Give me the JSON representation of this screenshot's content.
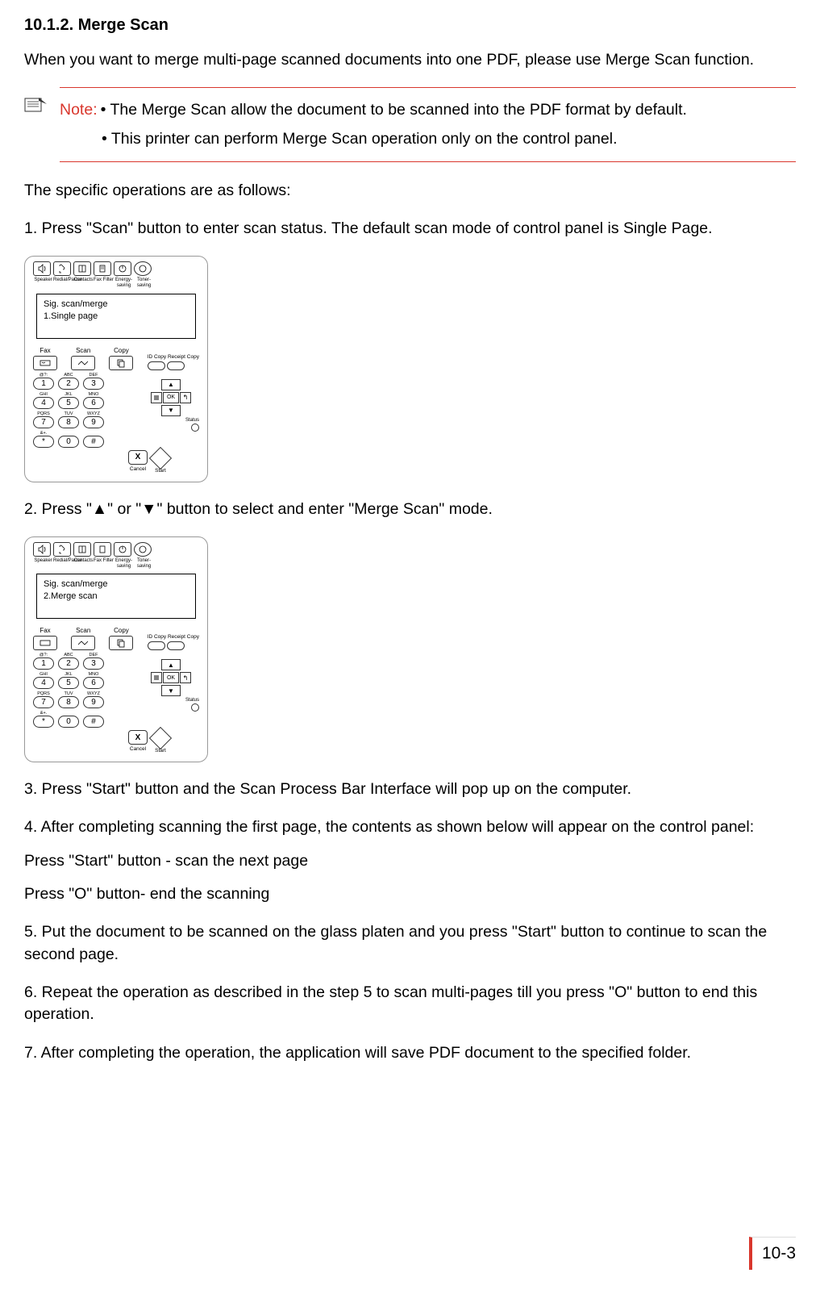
{
  "heading": "10.1.2. Merge Scan",
  "intro": "When you want to merge multi-page scanned documents into one PDF, please use Merge Scan function.",
  "note": {
    "label": "Note:",
    "bullets": [
      "• The Merge Scan allow the document to be scanned into the PDF format by default.",
      "• This printer can perform Merge Scan operation only on the control panel."
    ]
  },
  "ops_intro": "The specific operations are as follows:",
  "step1": "1. Press \"Scan\" button to enter scan status. The default scan mode of control panel is Single Page.",
  "panel1": {
    "icon_labels": [
      "Speaker",
      "Redial/Pause",
      "Contacts",
      "Fax Filter",
      "Energy-saving",
      "Toner-saving"
    ],
    "lcd_line1": "Sig. scan/merge",
    "lcd_line2": "1.Single page",
    "modes": [
      "Fax",
      "Scan",
      "Copy"
    ],
    "copy_labels": "ID Copy Receipt Copy",
    "key_labels1": [
      "@?:",
      "ABC",
      "DEF"
    ],
    "keys1": [
      "1",
      "2",
      "3"
    ],
    "key_labels2": [
      "GHI",
      "JKL",
      "MNO"
    ],
    "keys2": [
      "4",
      "5",
      "6"
    ],
    "key_labels3": [
      "PQRS",
      "TUV",
      "WXYZ"
    ],
    "keys3": [
      "7",
      "8",
      "9"
    ],
    "key_labels4": [
      "&+.",
      "",
      ""
    ],
    "keys4": [
      "*",
      "0",
      "#"
    ],
    "ok": "OK",
    "status": "Status",
    "cancel_icon": "X",
    "cancel": "Cancel",
    "start": "Start"
  },
  "step2": "2. Press \"▲\" or \"▼\" button to select and enter \"Merge Scan\" mode.",
  "panel2": {
    "lcd_line1": "Sig. scan/merge",
    "lcd_line2": "2.Merge scan"
  },
  "step3": "3. Press \"Start\" button and the Scan Process Bar Interface will pop up on the computer.",
  "step4": "4. After completing scanning the first page, the contents as shown below will appear on the control panel:",
  "step4a": "Press \"Start\" button - scan the next page",
  "step4b": "Press \"O\" button- end the scanning",
  "step5": "5. Put the document to be scanned on the glass platen and you press \"Start\" button to continue to scan the second page.",
  "step6": "6. Repeat the operation as described in the step 5 to scan multi-pages till you press \"O\" button to end this operation.",
  "step7": "7. After completing the operation, the application will save PDF document to the specified folder.",
  "page_num": "10-3"
}
